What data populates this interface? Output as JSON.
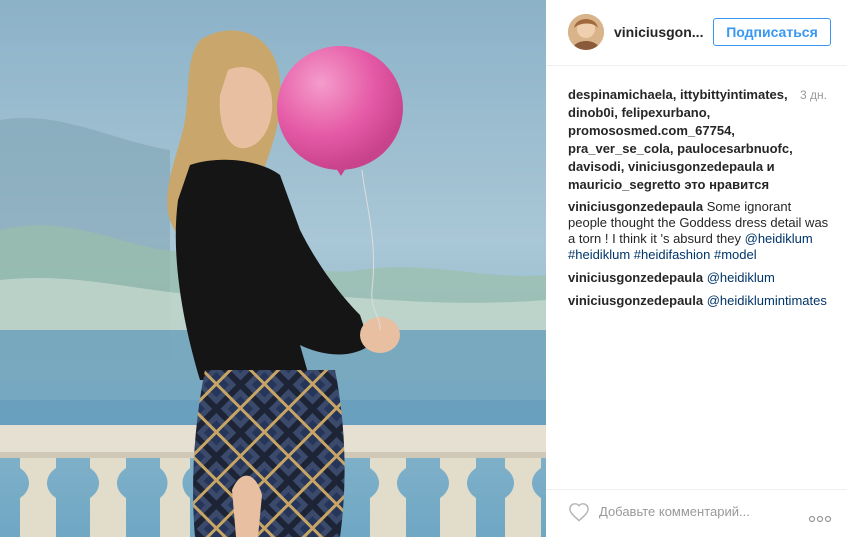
{
  "post": {
    "username": "viniciusgon...",
    "follow_label": "Подписаться",
    "likes_text": "despinamichaela, ittybittyintimates, dinob0i, felipexurbano, promososmed.com_67754, pra_ver_se_cola, paulocesarbnuofc, davisodi, viniciusgonzedepaula и mauricio_segretto это нравится",
    "time": "3 дн.",
    "comments": [
      {
        "author": "viniciusgonzedepaula",
        "text": " Some ignorant people thought the Goddess dress detail was a torn ! I think it 's absurd they ",
        "tags": "@heidiklum #heidiklum #heidifashion #model"
      },
      {
        "author": "viniciusgonzedepaula",
        "text": " ",
        "tags": "@heidiklum"
      },
      {
        "author": "viniciusgonzedepaula",
        "text": " ",
        "tags": "@heidiklumintimates"
      }
    ],
    "add_comment_placeholder": "Добавьте комментарий...",
    "icons": {
      "like": "heart-outline-icon",
      "more": "more-options-icon"
    }
  },
  "colors": {
    "accent": "#3897f0",
    "link": "#003569",
    "muted": "#999999",
    "balloon": "#e55aa6"
  }
}
